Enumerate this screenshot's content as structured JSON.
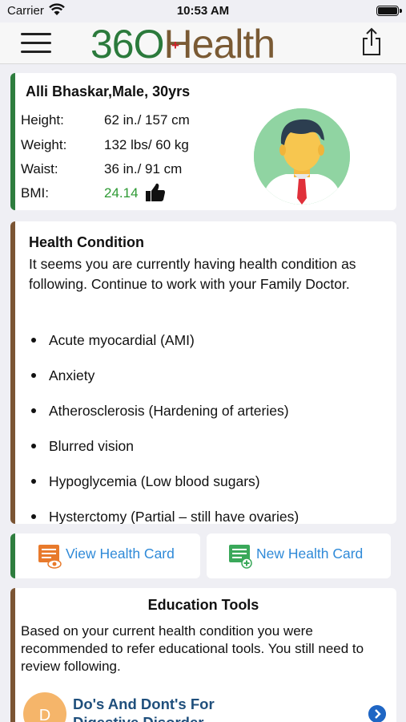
{
  "status_bar": {
    "carrier": "Carrier",
    "time": "10:53 AM"
  },
  "header": {
    "logo_number": "36",
    "logo_o": "O",
    "logo_word": "Health",
    "logo_plus": "+"
  },
  "profile": {
    "name": "Alli Bhaskar,Male, 30yrs",
    "stats": [
      {
        "label": "Height:",
        "value": "62 in./ 157 cm"
      },
      {
        "label": "Weight:",
        "value": "132 lbs/ 60 kg"
      },
      {
        "label": "Waist:",
        "value": "36 in./ 91 cm"
      },
      {
        "label": "BMI:",
        "value": "24.14"
      }
    ]
  },
  "health_condition": {
    "title": "Health Condition",
    "intro": "It seems you are currently having health condition as following. Continue to work with your Family Doctor.",
    "items": [
      "Acute myocardial (AMI)",
      "Anxiety",
      "Atherosclerosis (Hardening of arteries)",
      "Blurred vision",
      "Hypoglycemia (Low blood sugars)",
      "Hysterctomy (Partial – still have ovaries)"
    ]
  },
  "actions": {
    "view_card": "View Health Card",
    "new_card": "New Health Card"
  },
  "education": {
    "title": "Education Tools",
    "description": "Based on your current health condition you were recommended to refer educational tools. You still need to review following.",
    "item_letter": "D",
    "item_title": "Do's And Dont's For Digestive Disorder"
  },
  "colors": {
    "accent_green": "#2e7d3e",
    "accent_brown": "#7b5534",
    "link_blue": "#2f8ad8",
    "bmi_green": "#2e9a34"
  }
}
